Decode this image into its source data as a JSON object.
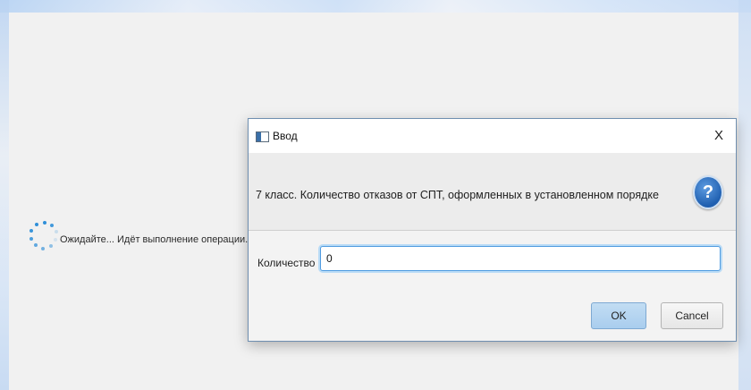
{
  "background": {
    "wait_text": "Ожидайте... Идёт выполнение операции."
  },
  "dialog": {
    "title": "Ввод",
    "close_glyph": "X",
    "message": "7 класс. Количество отказов от СПТ, оформленных в установленном порядке",
    "question_icon": "?",
    "field_label": "Количество",
    "field_value": "0",
    "ok_label": "OK",
    "cancel_label": "Cancel"
  },
  "colors": {
    "accent": "#2f8fd8",
    "ok_button": "#a9cdee",
    "question_icon": "#1f5fb0"
  }
}
